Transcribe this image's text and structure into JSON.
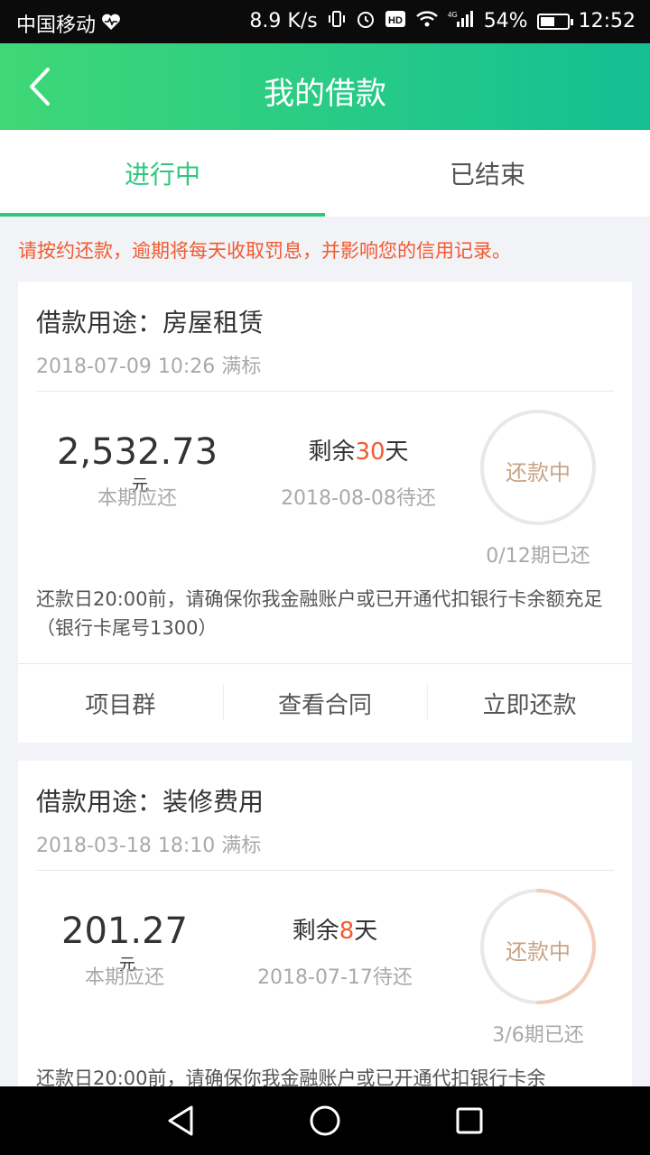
{
  "status_bar": {
    "carrier": "中国移动",
    "heart_icon": "heart-pulse-icon",
    "speed": "8.9 K/s",
    "network": "4G",
    "battery": "54%",
    "battery_level": 0.54,
    "time": "12:52"
  },
  "header": {
    "title": "我的借款",
    "back_icon": "chevron-left-icon"
  },
  "tabs": [
    {
      "label": "进行中",
      "active": true
    },
    {
      "label": "已结束",
      "active": false
    }
  ],
  "notice": "请按约还款，逾期将每天收取罚息，并影响您的信用记录。",
  "colors": {
    "accent": "#2fc77e",
    "warning": "#f25a2f",
    "ring_text": "#c9a383"
  },
  "loans": [
    {
      "purpose": "借款用途：房屋租赁",
      "date": "2018-07-09 10:26 满标",
      "amount": "2,532.73",
      "unit": "元",
      "amount_label": "本期应还",
      "remain_prefix": "剩余",
      "remain_days": "30",
      "remain_suffix": "天",
      "due": "2018-08-08待还",
      "status": "还款中",
      "periods": "0/12期已还",
      "progress": 0.0,
      "tip": "还款日20:00前，请确保你我金融账户或已开通代扣银行卡余额充足（银行卡尾号1300）",
      "actions": [
        "项目群",
        "查看合同",
        "立即还款"
      ]
    },
    {
      "purpose": "借款用途：装修费用",
      "date": "2018-03-18 18:10 满标",
      "amount": "201.27",
      "unit": "元",
      "amount_label": "本期应还",
      "remain_prefix": "剩余",
      "remain_days": "8",
      "remain_suffix": "天",
      "due": "2018-07-17待还",
      "status": "还款中",
      "periods": "3/6期已还",
      "progress": 0.5,
      "tip": "还款日20:00前，请确保你我金融账户或已开通代扣银行卡余"
    }
  ],
  "nav": {
    "back_icon": "triangle-back-icon",
    "home_icon": "circle-home-icon",
    "recent_icon": "square-recent-icon"
  }
}
